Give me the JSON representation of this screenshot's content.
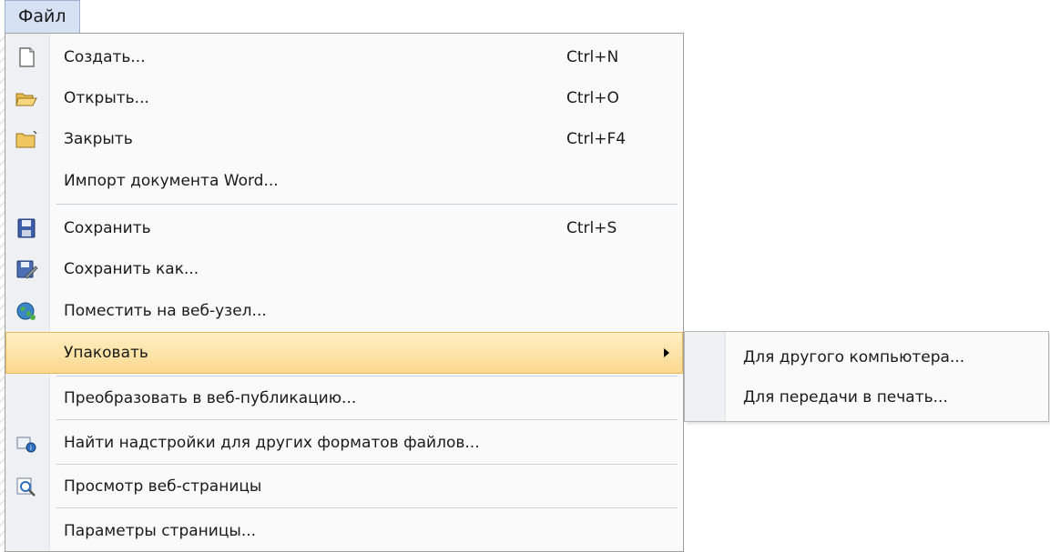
{
  "menubar": {
    "file_label": "Файл"
  },
  "menu": {
    "items": [
      {
        "label": "Создать...",
        "shortcut": "Ctrl+N",
        "icon": "new-document-icon"
      },
      {
        "label": "Открыть...",
        "shortcut": "Ctrl+O",
        "icon": "open-folder-icon"
      },
      {
        "label": "Закрыть",
        "shortcut": "Ctrl+F4",
        "icon": "close-folder-icon"
      },
      {
        "label": "Импорт документа Word...",
        "shortcut": "",
        "icon": ""
      },
      {
        "label": "Сохранить",
        "shortcut": "Ctrl+S",
        "icon": "save-icon"
      },
      {
        "label": "Сохранить как...",
        "shortcut": "",
        "icon": "save-as-icon"
      },
      {
        "label": "Поместить на веб-узел...",
        "shortcut": "",
        "icon": "globe-icon"
      },
      {
        "label": "Упаковать",
        "shortcut": "",
        "icon": "",
        "state": "highlighted",
        "has_submenu": true
      },
      {
        "label": "Преобразовать в веб-публикацию...",
        "shortcut": "",
        "icon": ""
      },
      {
        "label": "Найти надстройки для других форматов файлов...",
        "shortcut": "",
        "icon": "find-addins-icon"
      },
      {
        "label": "Просмотр веб-страницы",
        "shortcut": "",
        "icon": "web-preview-icon"
      },
      {
        "label": "Параметры страницы...",
        "shortcut": "",
        "icon": ""
      }
    ]
  },
  "submenu": {
    "items": [
      {
        "label": "Для другого компьютера..."
      },
      {
        "label": "Для передачи в печать..."
      }
    ]
  },
  "colors": {
    "highlight_top": "#fef0c3",
    "highlight_bottom": "#fbd88e",
    "menubar_active": "#d6e2f3"
  }
}
